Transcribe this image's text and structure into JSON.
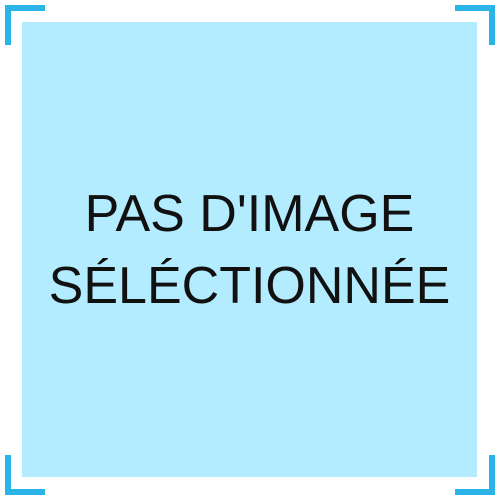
{
  "placeholder": {
    "line1": "PAS D'IMAGE",
    "line2": "SÉLÉCTIONNÉE"
  },
  "colors": {
    "panel_background": "#b3ecff",
    "corner_accent": "#2ab4e8",
    "text": "#111111"
  },
  "icons": {
    "corners": [
      "corner-bracket-top-left",
      "corner-bracket-top-right",
      "corner-bracket-bottom-left",
      "corner-bracket-bottom-right"
    ]
  }
}
